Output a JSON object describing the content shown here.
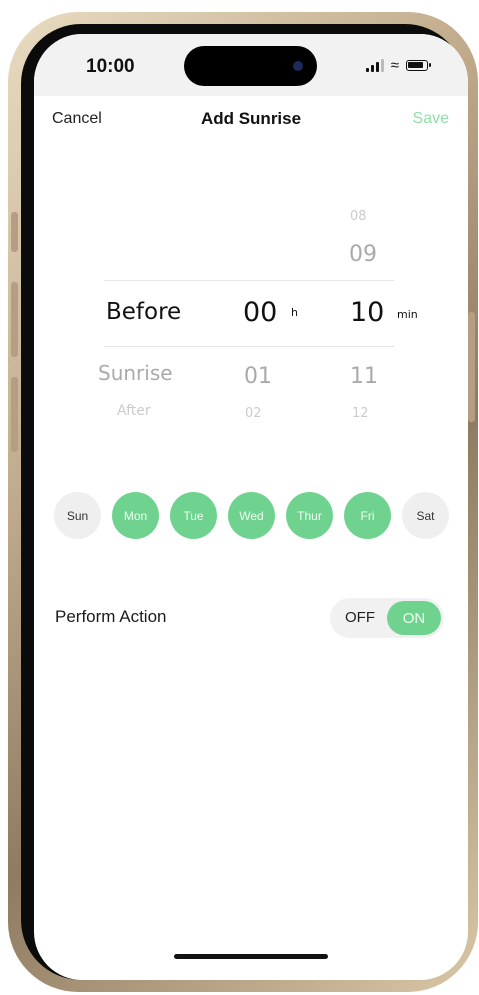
{
  "status_bar": {
    "time": "10:00"
  },
  "nav": {
    "cancel": "Cancel",
    "title": "Add Sunrise",
    "save": "Save"
  },
  "picker": {
    "relation": {
      "selected": "Before",
      "below": [
        "Sunrise",
        "After"
      ]
    },
    "hours": {
      "selected": "00",
      "unit": "h",
      "below": [
        "01",
        "02"
      ]
    },
    "minutes": {
      "above": [
        "08",
        "09"
      ],
      "selected": "10",
      "unit": "min",
      "below": [
        "11",
        "12"
      ]
    }
  },
  "days": [
    {
      "label": "Sun",
      "active": false
    },
    {
      "label": "Mon",
      "active": true
    },
    {
      "label": "Tue",
      "active": true
    },
    {
      "label": "Wed",
      "active": true
    },
    {
      "label": "Thur",
      "active": true
    },
    {
      "label": "Fri",
      "active": true
    },
    {
      "label": "Sat",
      "active": false
    }
  ],
  "perform_action": {
    "label": "Perform Action",
    "off_label": "OFF",
    "on_label": "ON",
    "state": "ON"
  },
  "colors": {
    "accent": "#6fd38f",
    "save_text": "#8fe0a8",
    "inactive_day": "#efefef"
  }
}
